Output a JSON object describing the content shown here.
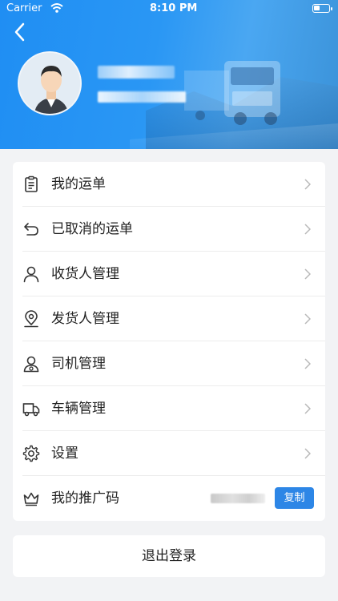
{
  "status_bar": {
    "carrier": "Carrier",
    "time": "8:10 PM"
  },
  "header": {
    "back_icon": "chevron-left-icon",
    "avatar": "avatar-person",
    "user_name_text": "",
    "user_phone_text": ""
  },
  "menu": {
    "items": [
      {
        "label": "我的运单",
        "icon": "clipboard-icon"
      },
      {
        "label": "已取消的运单",
        "icon": "undo-arrow-icon"
      },
      {
        "label": "收货人管理",
        "icon": "person-icon"
      },
      {
        "label": "发货人管理",
        "icon": "location-pin-icon"
      },
      {
        "label": "司机管理",
        "icon": "driver-icon"
      },
      {
        "label": "车辆管理",
        "icon": "truck-icon"
      },
      {
        "label": "设置",
        "icon": "gear-icon"
      }
    ],
    "promo": {
      "label": "我的推广码",
      "icon": "crown-icon",
      "copy_label": "复制"
    }
  },
  "logout_label": "退出登录",
  "colors": {
    "header_blue": "#2a97f4",
    "accent_blue": "#2d86e6",
    "background": "#f2f3f5"
  }
}
